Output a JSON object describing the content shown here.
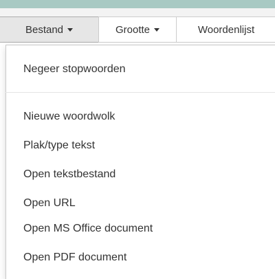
{
  "menubar": {
    "tabs": [
      {
        "label": "Bestand"
      },
      {
        "label": "Grootte"
      },
      {
        "label": "Woordenlijst"
      }
    ]
  },
  "dropdown": {
    "items": [
      {
        "label": "Negeer stopwoorden"
      },
      {
        "label": "Nieuwe woordwolk"
      },
      {
        "label": "Plak/type tekst"
      },
      {
        "label": "Open tekstbestand"
      },
      {
        "label": "Open URL"
      },
      {
        "label": "Open MS Office document"
      },
      {
        "label": "Open PDF document"
      }
    ]
  },
  "colors": {
    "top_strip": "#a8c9c3",
    "navbar_bg": "#f3f3f3",
    "active_tab_bg": "#e6e6e6",
    "text": "#333333"
  }
}
